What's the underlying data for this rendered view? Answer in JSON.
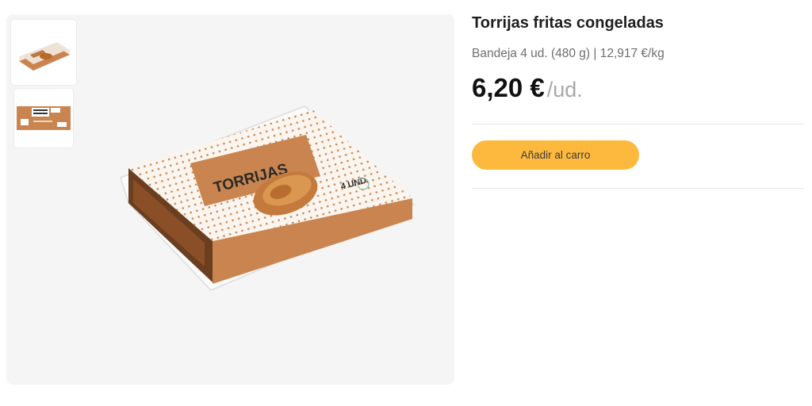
{
  "product": {
    "title": "Torrijas fritas congeladas",
    "subtitle": "Bandeja 4 ud. (480 g) | 12,917 €/kg",
    "price": "6,20 €",
    "price_unit": "/ud.",
    "add_to_cart_label": "Añadir al carro"
  },
  "gallery": {
    "box_label": "TORRIJAS",
    "units_label": "4 UND.",
    "thumbnails": [
      "front-view",
      "back-label-view"
    ],
    "selected_thumbnail": 0
  },
  "colors": {
    "accent_button": "#fdb93d",
    "packaging_orange": "#c9844f",
    "gallery_bg": "#f5f5f5"
  }
}
